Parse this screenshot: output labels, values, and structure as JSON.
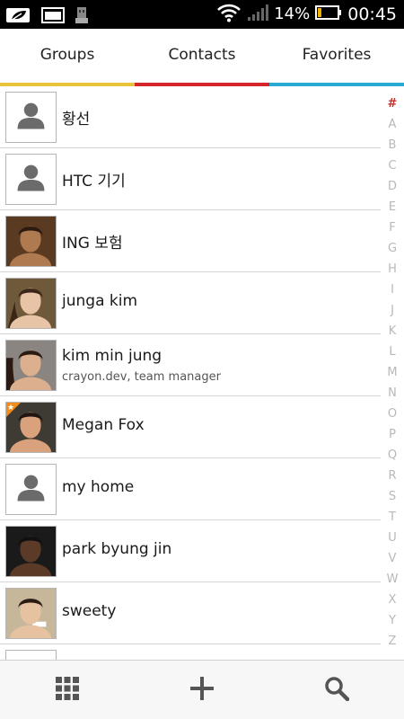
{
  "status_bar": {
    "battery_percent": "14%",
    "time": "00:45",
    "icons": [
      "notification-leaf-icon",
      "gallery-icon",
      "usb-icon",
      "wifi-icon",
      "signal-icon",
      "battery-icon"
    ],
    "battery_level": 0.14,
    "battery_color": "#f0b400"
  },
  "tabs": [
    {
      "label": "Groups",
      "color": "#e8c23a"
    },
    {
      "label": "Contacts",
      "color": "#d4252a"
    },
    {
      "label": "Favorites",
      "color": "#2aa9d4"
    }
  ],
  "contacts": [
    {
      "name": "황선",
      "subtitle": "",
      "avatar": "placeholder"
    },
    {
      "name": "HTC 기기",
      "subtitle": "",
      "avatar": "placeholder"
    },
    {
      "name": "ING 보험",
      "subtitle": "",
      "avatar": "photo-man"
    },
    {
      "name": "junga kim",
      "subtitle": "",
      "avatar": "photo-woman-1"
    },
    {
      "name": "kim min jung",
      "subtitle": "crayon.dev, team manager",
      "avatar": "photo-woman-2"
    },
    {
      "name": "Megan Fox",
      "subtitle": "",
      "avatar": "photo-woman-3",
      "favorite": true
    },
    {
      "name": "my home",
      "subtitle": "",
      "avatar": "placeholder"
    },
    {
      "name": "park byung jin",
      "subtitle": "",
      "avatar": "photo-man-2"
    },
    {
      "name": "sweety",
      "subtitle": "",
      "avatar": "photo-woman-4"
    }
  ],
  "alpha_index": [
    "#",
    "A",
    "B",
    "C",
    "D",
    "E",
    "F",
    "G",
    "H",
    "I",
    "J",
    "K",
    "L",
    "M",
    "N",
    "O",
    "P",
    "Q",
    "R",
    "S",
    "T",
    "U",
    "V",
    "W",
    "X",
    "Y",
    "Z"
  ],
  "alpha_active": "#",
  "toolbar": {
    "icons": [
      "grid-icon",
      "add-icon",
      "search-icon"
    ]
  }
}
